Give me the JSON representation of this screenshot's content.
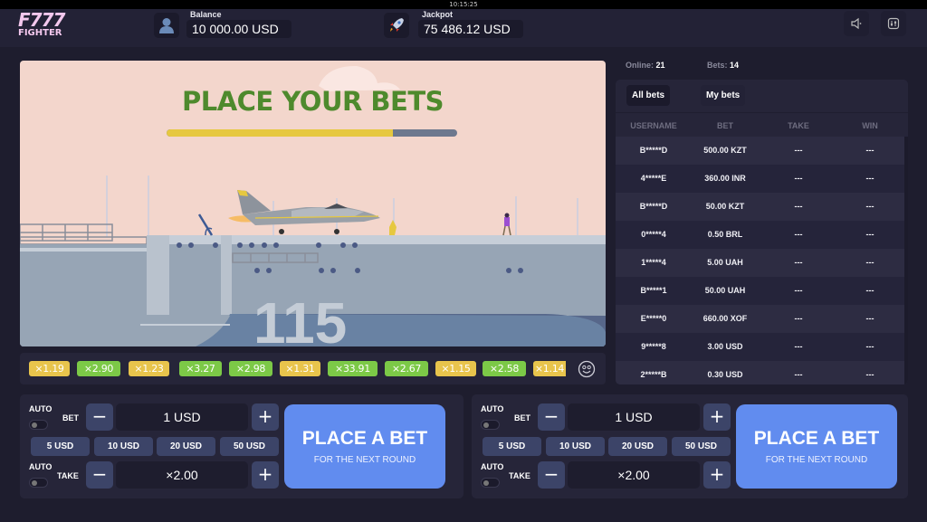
{
  "system": {
    "clock": "10:15:25"
  },
  "header": {
    "logo_line1": "F777",
    "logo_line2": "FIGHTER",
    "balance_label": "Balance",
    "balance_value": "10 000.00 USD",
    "jackpot_label": "Jackpot",
    "jackpot_value": "75 486.12 USD",
    "icons": [
      "user-icon",
      "rocket-icon",
      "sound-icon",
      "settings-icon"
    ]
  },
  "game": {
    "title": "PLACE YOUR BETS",
    "countdown_progress": 0.78,
    "ship_number": "115",
    "colors": {
      "title": "#4e8a2d",
      "progress_fill": "#e6c840",
      "progress_track": "#6d788e",
      "sky": "#f3d6cc"
    }
  },
  "history": {
    "multipliers": [
      {
        "value": "×1.19",
        "color": "yellow"
      },
      {
        "value": "×2.90",
        "color": "green"
      },
      {
        "value": "×1.23",
        "color": "yellow"
      },
      {
        "value": "×3.27",
        "color": "green"
      },
      {
        "value": "×2.98",
        "color": "green"
      },
      {
        "value": "×1.31",
        "color": "yellow"
      },
      {
        "value": "×33.91",
        "color": "green"
      },
      {
        "value": "×2.67",
        "color": "green"
      },
      {
        "value": "×1.15",
        "color": "yellow"
      },
      {
        "value": "×2.58",
        "color": "green"
      },
      {
        "value": "×1.14",
        "color": "yellow"
      }
    ],
    "emoji_icon": "smiley-icon"
  },
  "stats": {
    "online_label": "Online:",
    "online_value": "21",
    "bets_label": "Bets:",
    "bets_value": "14"
  },
  "bets_panel": {
    "tabs": [
      {
        "label": "All bets",
        "active": true
      },
      {
        "label": "My bets",
        "active": false
      }
    ],
    "columns": [
      "USERNAME",
      "BET",
      "TAKE",
      "WIN"
    ],
    "rows": [
      {
        "username": "B*****D",
        "bet": "500.00 KZT",
        "take": "---",
        "win": "---"
      },
      {
        "username": "4*****E",
        "bet": "360.00 INR",
        "take": "---",
        "win": "---"
      },
      {
        "username": "B*****D",
        "bet": "50.00 KZT",
        "take": "---",
        "win": "---"
      },
      {
        "username": "0*****4",
        "bet": "0.50 BRL",
        "take": "---",
        "win": "---"
      },
      {
        "username": "1*****4",
        "bet": "5.00 UAH",
        "take": "---",
        "win": "---"
      },
      {
        "username": "B*****1",
        "bet": "50.00 UAH",
        "take": "---",
        "win": "---"
      },
      {
        "username": "E*****0",
        "bet": "660.00 XOF",
        "take": "---",
        "win": "---"
      },
      {
        "username": "9*****8",
        "bet": "3.00 USD",
        "take": "---",
        "win": "---"
      },
      {
        "username": "2*****B",
        "bet": "0.30 USD",
        "take": "---",
        "win": "---"
      }
    ]
  },
  "bet_panels": [
    {
      "auto_label": "AUTO",
      "bet_label": "BET",
      "bet_value": "1 USD",
      "quick_amounts": [
        "5 USD",
        "10 USD",
        "20 USD",
        "50 USD"
      ],
      "take_label": "TAKE",
      "take_value": "×2.00",
      "minus": "−",
      "plus": "+",
      "place_label": "PLACE A BET",
      "place_sub": "FOR THE NEXT ROUND",
      "auto_bet_on": false,
      "auto_take_on": false
    },
    {
      "auto_label": "AUTO",
      "bet_label": "BET",
      "bet_value": "1 USD",
      "quick_amounts": [
        "5 USD",
        "10 USD",
        "20 USD",
        "50 USD"
      ],
      "take_label": "TAKE",
      "take_value": "×2.00",
      "minus": "−",
      "plus": "+",
      "place_label": "PLACE A BET",
      "place_sub": "FOR THE NEXT ROUND",
      "auto_bet_on": false,
      "auto_take_on": false
    }
  ],
  "colors": {
    "accent": "#618cef",
    "panel": "#262539",
    "background": "#1e1d2e",
    "chip_yellow": "#e8c44c",
    "chip_green": "#7cc947"
  }
}
